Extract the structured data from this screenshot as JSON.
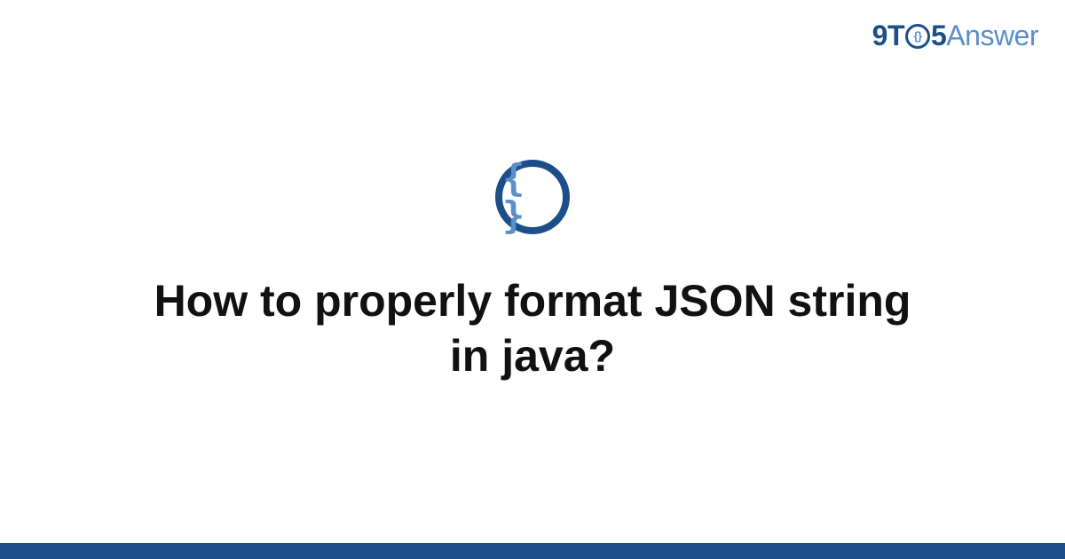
{
  "logo": {
    "part_9t": "9T",
    "part_o_inner": "{}",
    "part_5": "5",
    "part_answer": "Answer"
  },
  "icon": {
    "braces": "{ }",
    "name": "json-braces-icon"
  },
  "title": "How to properly format JSON string in java?",
  "colors": {
    "brand_dark": "#1c4e8a",
    "brand_light": "#5a8fc7",
    "text": "#111111",
    "background": "#ffffff"
  }
}
